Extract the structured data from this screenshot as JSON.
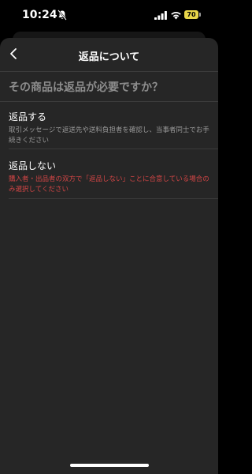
{
  "status_bar": {
    "time": "10:24",
    "battery": "70",
    "battery_color": "#e8d64a"
  },
  "header": {
    "title": "返品について"
  },
  "question": "その商品は返品が必要ですか？",
  "options": [
    {
      "title": "返品する",
      "description": "取引メッセージで返送先や送料負担者を確認し、当事者同士でお手続きください"
    },
    {
      "title": "返品しない",
      "description": "購入者・出品者の双方で「返品しない」ことに合意している場合のみ選択してください",
      "description_color": "#d24545"
    }
  ]
}
